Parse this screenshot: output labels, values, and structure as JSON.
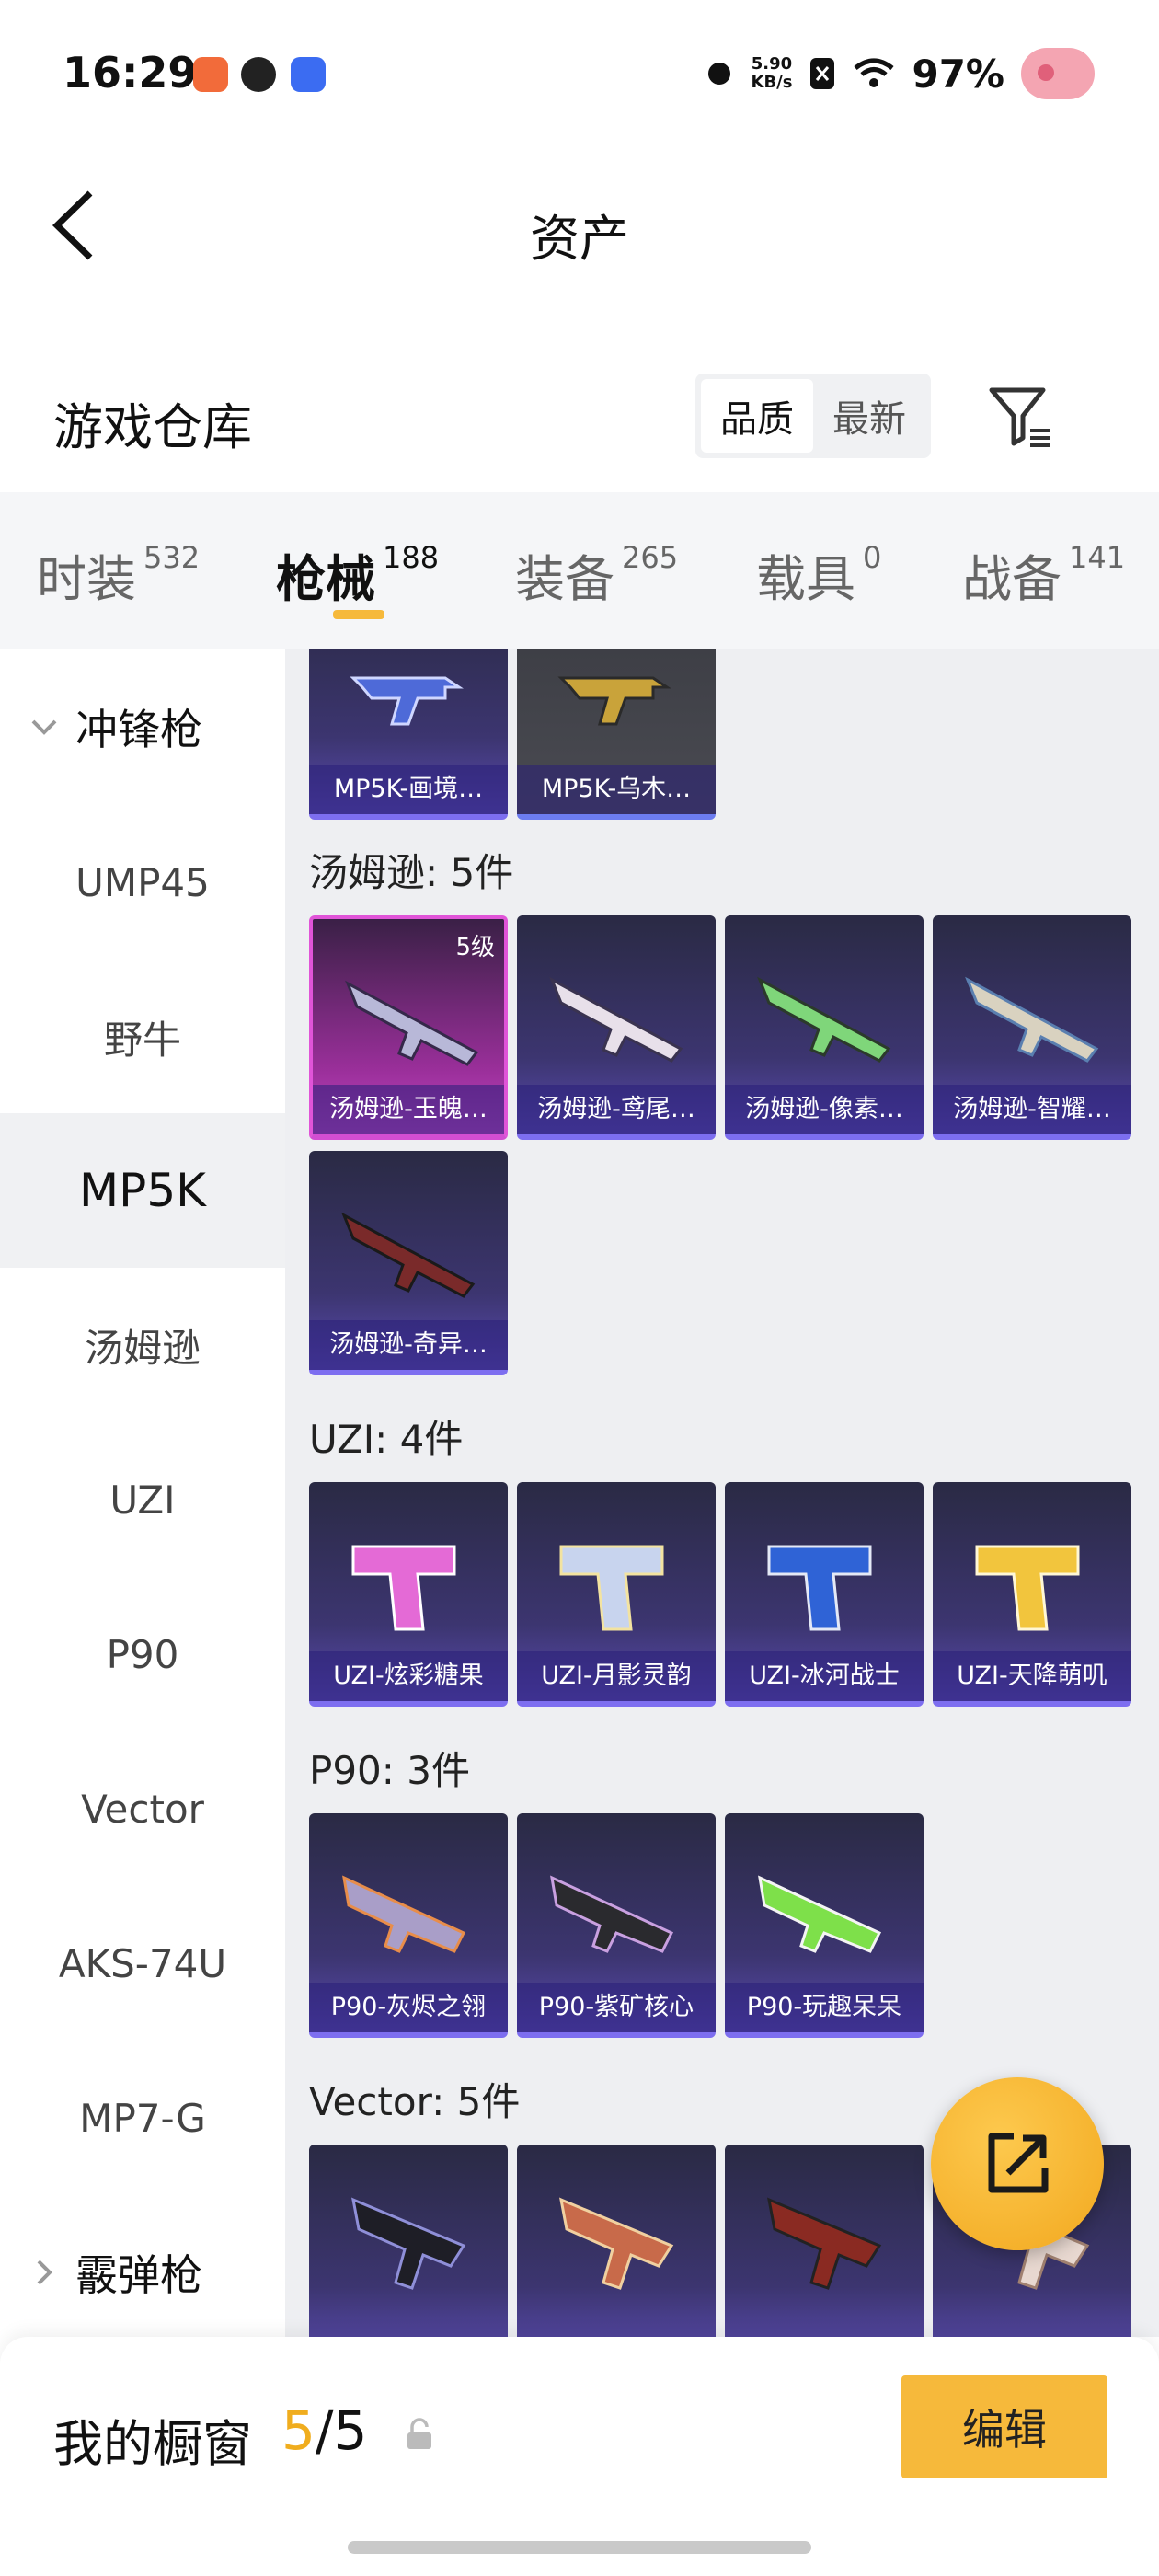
{
  "status_bar": {
    "time": "16:29",
    "net_speed_value": "5.90",
    "net_speed_unit": "KB/s",
    "battery": "97%",
    "icons": [
      "app-icon-1",
      "app-icon-2",
      "app-icon-3",
      "bluetooth-icon",
      "sim-icon",
      "wifi-icon",
      "pig-avatar-icon"
    ]
  },
  "header": {
    "title": "资产",
    "back_icon": "back-arrow-icon"
  },
  "warehouse": {
    "title": "游戏仓库",
    "sort_options": [
      "品质",
      "最新"
    ],
    "sort_active": "品质",
    "filter_icon": "filter-icon"
  },
  "tabs": [
    {
      "label": "时装",
      "count": "532"
    },
    {
      "label": "枪械",
      "count": "188",
      "active": true
    },
    {
      "label": "装备",
      "count": "265"
    },
    {
      "label": "载具",
      "count": "0"
    },
    {
      "label": "战备",
      "count": "141"
    }
  ],
  "sidebar": {
    "group_open": "冲锋枪",
    "items": [
      "UMP45",
      "野牛",
      "MP5K",
      "汤姆逊",
      "UZI",
      "P90",
      "Vector",
      "AKS-74U",
      "MP7-G"
    ],
    "active_item": "MP5K",
    "group_closed": "霰弹枪"
  },
  "sections": {
    "mp5k": {
      "cards": [
        {
          "name": "MP5K-画境…",
          "style": "purple"
        },
        {
          "name": "MP5K-乌木…",
          "style": "gold"
        }
      ]
    },
    "thompson": {
      "title": "汤姆逊: 5件",
      "cards": [
        {
          "name": "汤姆逊-玉魄…",
          "level": "5级",
          "style": "pink"
        },
        {
          "name": "汤姆逊-鸢尾…",
          "style": "purple"
        },
        {
          "name": "汤姆逊-像素…",
          "style": "purple"
        },
        {
          "name": "汤姆逊-智耀…",
          "style": "purple"
        },
        {
          "name": "汤姆逊-奇异…",
          "style": "purple"
        }
      ]
    },
    "uzi": {
      "title": "UZI: 4件",
      "cards": [
        {
          "name": "UZI-炫彩糖果",
          "style": "purple"
        },
        {
          "name": "UZI-月影灵韵",
          "style": "purple"
        },
        {
          "name": "UZI-冰河战士",
          "style": "purple"
        },
        {
          "name": "UZI-天降萌叽",
          "style": "purple"
        }
      ]
    },
    "p90": {
      "title": "P90: 3件",
      "cards": [
        {
          "name": "P90-灰烬之翎",
          "style": "purple"
        },
        {
          "name": "P90-紫矿核心",
          "style": "purple"
        },
        {
          "name": "P90-玩趣呆呆",
          "style": "purple"
        }
      ]
    },
    "vector": {
      "title": "Vector: 5件"
    }
  },
  "fab_icon": "share-export-icon",
  "bottom": {
    "showcase_label": "我的橱窗",
    "showcase_current": "5",
    "showcase_total": "/5",
    "edit_label": "编辑",
    "lock_icon": "lock-icon"
  },
  "colors": {
    "accent": "#f6b93b",
    "card_purple": "#5a4bb0",
    "card_pink": "#c247c2"
  }
}
